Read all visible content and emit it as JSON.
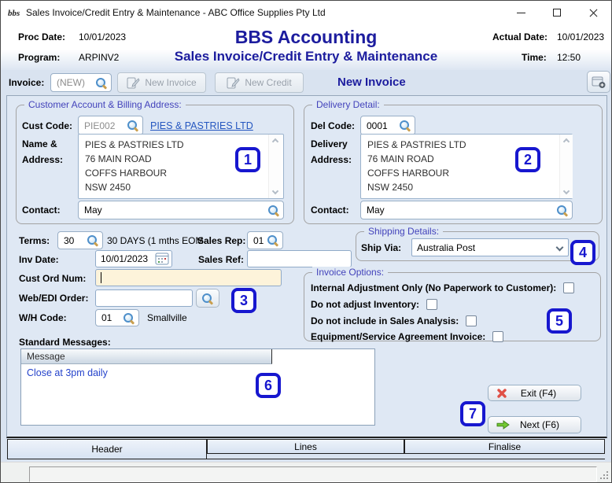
{
  "window": {
    "title": "Sales Invoice/Credit Entry & Maintenance - ABC Office Supplies Pty Ltd"
  },
  "header": {
    "proc_date_label": "Proc Date:",
    "proc_date": "10/01/2023",
    "program_label": "Program:",
    "program": "ARPINV2",
    "app_title": "BBS Accounting",
    "screen_title": "Sales Invoice/Credit Entry & Maintenance",
    "actual_date_label": "Actual Date:",
    "actual_date": "10/01/2023",
    "time_label": "Time:",
    "time": "12:50"
  },
  "invoice_bar": {
    "label": "Invoice:",
    "invoice_value": "(NEW)",
    "new_invoice_button": "New Invoice",
    "new_credit_button": "New Credit",
    "status_heading": "New Invoice"
  },
  "customer": {
    "legend": "Customer Account & Billing Address:",
    "cust_code_label": "Cust Code:",
    "cust_code": "PIE002",
    "customer_link": "PIES & PASTRIES LTD",
    "name_address_label_1": "Name &",
    "name_address_label_2": "Address:",
    "address": "PIES & PASTRIES LTD\n76 MAIN ROAD\nCOFFS HARBOUR\nNSW 2450",
    "contact_label": "Contact:",
    "contact": "May"
  },
  "delivery": {
    "legend": "Delivery Detail:",
    "del_code_label": "Del Code:",
    "del_code": "0001",
    "address_label_1": "Delivery",
    "address_label_2": "Address:",
    "address": "PIES & PASTRIES LTD\n76 MAIN ROAD\nCOFFS HARBOUR\nNSW 2450",
    "contact_label": "Contact:",
    "contact": "May"
  },
  "details": {
    "terms_label": "Terms:",
    "terms": "30",
    "terms_desc": "30 DAYS (1 mths EOM",
    "sales_rep_label": "Sales Rep:",
    "sales_rep": "01",
    "inv_date_label": "Inv Date:",
    "inv_date": "10/01/2023",
    "sales_ref_label": "Sales Ref:",
    "sales_ref": "",
    "cust_ord_label": "Cust Ord Num:",
    "cust_ord": "",
    "web_edi_label": "Web/EDI Order:",
    "web_edi": "",
    "wh_code_label": "W/H Code:",
    "wh_code": "01",
    "wh_name": "Smallville"
  },
  "shipping": {
    "legend": "Shipping Details:",
    "ship_via_label": "Ship Via:",
    "ship_via": "Australia Post"
  },
  "invoice_options": {
    "legend": "Invoice Options:",
    "options": [
      {
        "label": "Internal Adjustment Only (No Paperwork to Customer):",
        "checked": false
      },
      {
        "label": "Do not adjust Inventory:",
        "checked": false
      },
      {
        "label": "Do not include in Sales Analysis:",
        "checked": false
      },
      {
        "label": "Equipment/Service Agreement Invoice:",
        "checked": false
      }
    ]
  },
  "messages": {
    "label": "Standard Messages:",
    "column_header": "Message",
    "rows": [
      "Close at 3pm daily"
    ]
  },
  "actions": {
    "exit": "Exit (F4)",
    "next": "Next (F6)"
  },
  "tabs": [
    {
      "label": "Header",
      "active": true
    },
    {
      "label": "Lines",
      "active": false
    },
    {
      "label": "Finalise",
      "active": false
    }
  ],
  "step_badges": [
    "1",
    "2",
    "3",
    "4",
    "5",
    "6",
    "7"
  ],
  "icons": {
    "lookup": "magnifier-icon",
    "calendar": "calendar-icon",
    "new_document": "new-document-icon",
    "exit": "red-cross-icon",
    "next": "green-arrow-icon"
  },
  "colors": {
    "accent_navy": "#1c1c9e",
    "legend_violet": "#4343bb",
    "link_blue": "#2456c0",
    "message_blue": "#2543cb",
    "badge_blue": "#1717cf",
    "highlight_cream": "#fdf3da",
    "panel_blue": "#dfe8f4",
    "exit_red": "#e05045",
    "next_green": "#6fc431"
  }
}
